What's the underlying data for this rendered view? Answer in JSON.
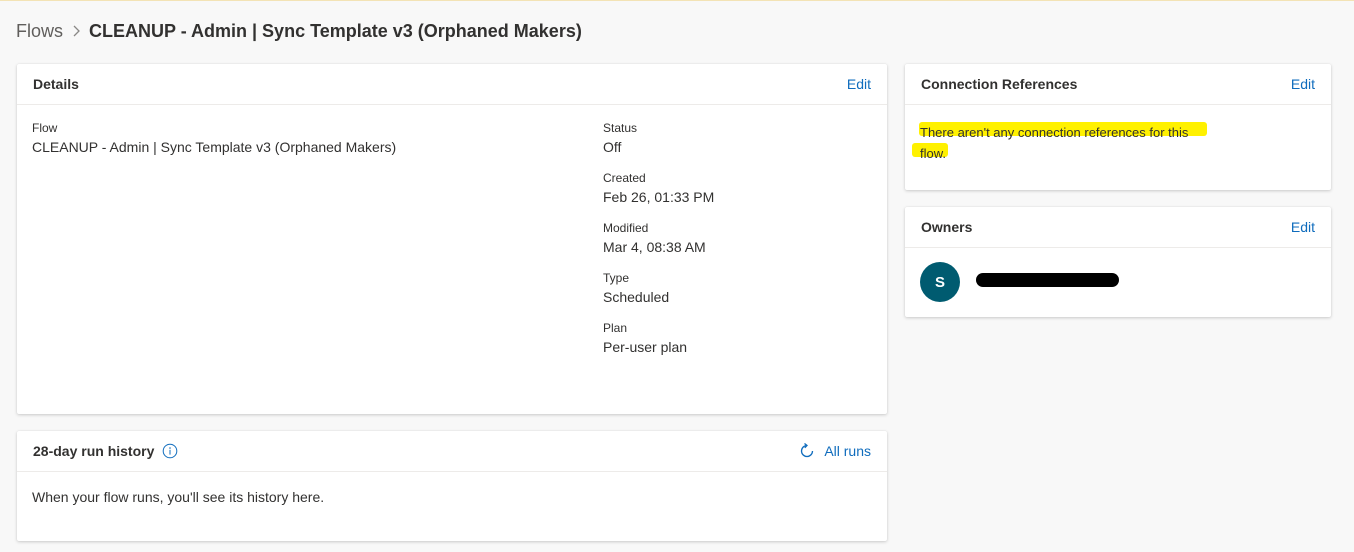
{
  "breadcrumb": {
    "root": "Flows",
    "current": "CLEANUP - Admin | Sync Template v3 (Orphaned Makers)"
  },
  "details": {
    "title": "Details",
    "edit": "Edit",
    "flow_label": "Flow",
    "flow_value": "CLEANUP - Admin | Sync Template v3 (Orphaned Makers)",
    "status_label": "Status",
    "status_value": "Off",
    "created_label": "Created",
    "created_value": "Feb 26, 01:33 PM",
    "modified_label": "Modified",
    "modified_value": "Mar 4, 08:38 AM",
    "type_label": "Type",
    "type_value": "Scheduled",
    "plan_label": "Plan",
    "plan_value": "Per-user plan"
  },
  "history": {
    "title": "28-day run history",
    "all_runs": "All runs",
    "empty_message": "When your flow runs, you'll see its history here."
  },
  "connection_references": {
    "title": "Connection References",
    "edit": "Edit",
    "message_line1": "There aren't any connection references for this",
    "message_line2": "flow."
  },
  "owners": {
    "title": "Owners",
    "edit": "Edit",
    "avatar_initial": "S"
  },
  "colors": {
    "accent": "#0f6cbd",
    "avatar": "#005b70",
    "highlight": "#fff100"
  },
  "icons": {
    "breadcrumb_separator": "chevron-right-icon",
    "history_info": "info-icon",
    "all_runs": "refresh-icon"
  }
}
